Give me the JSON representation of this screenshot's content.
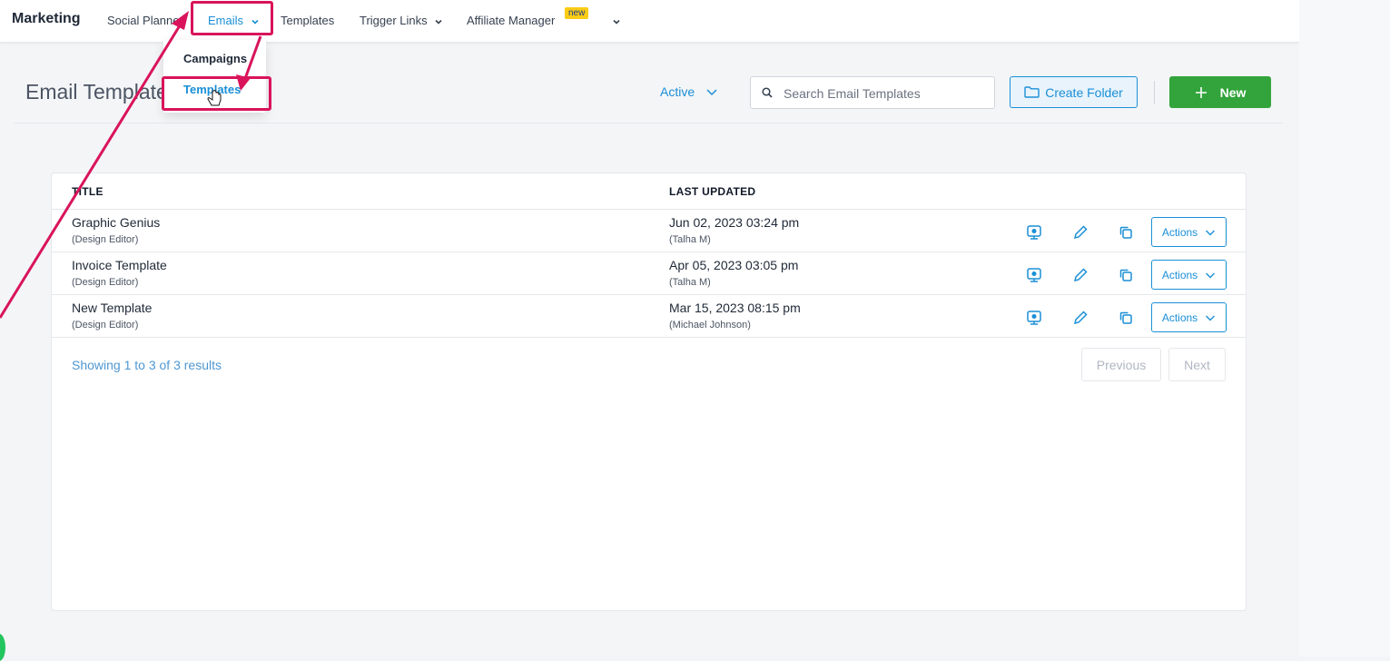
{
  "nav": {
    "brand": "Marketing",
    "items": [
      {
        "label": "Social Planner"
      },
      {
        "label": "Emails"
      },
      {
        "label": "Templates"
      },
      {
        "label": "Trigger Links"
      },
      {
        "label": "Affiliate Manager"
      }
    ],
    "new_badge": "new"
  },
  "dropdown": {
    "items": [
      {
        "label": "Campaigns"
      },
      {
        "label": "Templates"
      }
    ]
  },
  "header": {
    "title": "Email Templates",
    "status_filter": "Active",
    "search_placeholder": "Search Email Templates",
    "create_folder_label": "Create Folder",
    "new_label": "New"
  },
  "table": {
    "columns": [
      "TITLE",
      "LAST UPDATED"
    ],
    "rows": [
      {
        "title": "Graphic Genius",
        "editor": "(Design Editor)",
        "updated": "Jun 02, 2023 03:24 pm",
        "author": "(Talha M)",
        "actions": "Actions"
      },
      {
        "title": "Invoice Template",
        "editor": "(Design Editor)",
        "updated": "Apr 05, 2023 03:05 pm",
        "author": "(Talha M)",
        "actions": "Actions"
      },
      {
        "title": "New Template",
        "editor": "(Design Editor)",
        "updated": "Mar 15, 2023 08:15 pm",
        "author": "(Michael Johnson)",
        "actions": "Actions"
      }
    ],
    "summary": "Showing 1 to 3 of 3 results",
    "pagination": {
      "previous": "Previous",
      "next": "Next"
    }
  },
  "colors": {
    "accent": "#1a8fd6",
    "primary_green": "#32a43b",
    "annotation": "#d9145b",
    "badge": "#facc15"
  },
  "icons": [
    "search-icon",
    "chevron-down-icon",
    "folder-icon",
    "plus-icon",
    "preview-icon",
    "pencil-icon",
    "copy-icon",
    "cursor-hand-icon"
  ]
}
